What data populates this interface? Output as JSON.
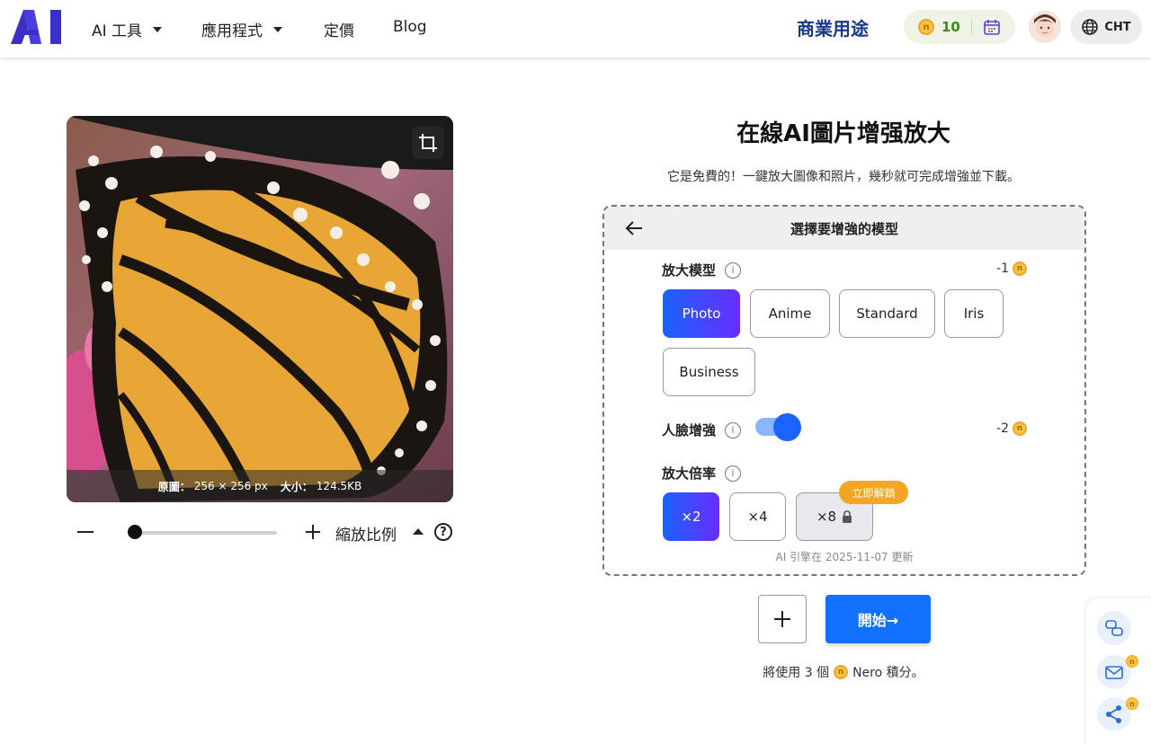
{
  "header": {
    "logo_text": "AI",
    "nav": [
      {
        "label": "AI 工具",
        "has_dropdown": true
      },
      {
        "label": "應用程式",
        "has_dropdown": true
      },
      {
        "label": "定價",
        "has_dropdown": false
      },
      {
        "label": "Blog",
        "has_dropdown": false
      }
    ],
    "business_label": "商業用途",
    "credits": "10",
    "coin_glyph": "n",
    "language": "CHT"
  },
  "preview": {
    "info_original_key": "原圖：",
    "info_original_val": "256 × 256 px",
    "info_size_key": "大小：",
    "info_size_val": "124.5KB"
  },
  "zoom": {
    "label": "縮放比例",
    "help": "?",
    "level": 0.05
  },
  "main": {
    "title": "在線AI圖片增强放大",
    "subtitle": "它是免費的！一鍵放大圖像和照片，幾秒就可完成增強並下載。"
  },
  "panel": {
    "title": "選擇要增強的模型",
    "model_label": "放大模型",
    "model_cost": "-1",
    "models": [
      "Photo",
      "Anime",
      "Standard",
      "Iris",
      "Business"
    ],
    "selected_model": "Photo",
    "face_label": "人臉增強",
    "face_cost": "-2",
    "face_enabled": true,
    "scale_label": "放大倍率",
    "scales": [
      "×2",
      "×4",
      "×8"
    ],
    "selected_scale": "×2",
    "unlock_label": "立即解鎖",
    "engine_note": "AI 引擎在 2025-11-07 更新",
    "info_glyph": "i"
  },
  "actions": {
    "start_label": "開始→",
    "usage_prefix": "將使用 3 個",
    "usage_suffix": "Nero 積分。"
  },
  "colors": {
    "accent": "#1270ff",
    "gradient_start": "#1a63ff",
    "gradient_end": "#6a2cff",
    "unlock": "#f5a524",
    "business": "#1a3a8c"
  }
}
